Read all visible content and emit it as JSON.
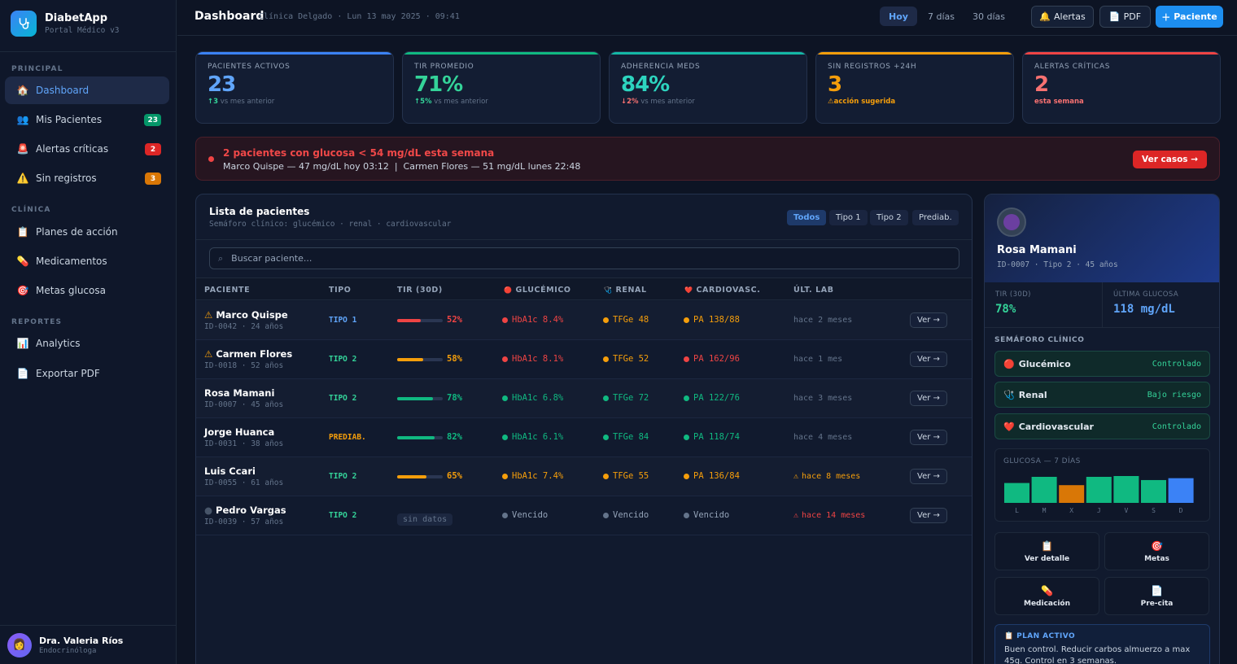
{
  "app": {
    "name": "DiabetApp",
    "subtitle": "Portal Médico v3",
    "logo_icon": "stethoscope-icon"
  },
  "sidebar": {
    "sections": [
      "PRINCIPAL",
      "CLÍNICA",
      "REPORTES"
    ],
    "items": [
      {
        "label": "Dashboard",
        "icon": "🏠",
        "icon_name": "home-icon",
        "active": true
      },
      {
        "label": "Mis Pacientes",
        "icon": "👥",
        "icon_name": "users-icon",
        "badge": "23",
        "badge_color": "#059669"
      },
      {
        "label": "Alertas críticas",
        "icon": "🚨",
        "icon_name": "siren-icon",
        "badge": "2",
        "badge_color": "#dc2626"
      },
      {
        "label": "Sin registros",
        "icon": "⚠️",
        "icon_name": "warning-icon",
        "badge": "3",
        "badge_color": "#d97706"
      },
      {
        "label": "Planes de acción",
        "icon": "📋",
        "icon_name": "clipboard-icon"
      },
      {
        "label": "Medicamentos",
        "icon": "💊",
        "icon_name": "pill-icon"
      },
      {
        "label": "Metas glucosa",
        "icon": "🎯",
        "icon_name": "target-icon"
      },
      {
        "label": "Analytics",
        "icon": "📊",
        "icon_name": "chart-icon"
      },
      {
        "label": "Exportar PDF",
        "icon": "📄",
        "icon_name": "document-icon"
      }
    ],
    "user": {
      "name": "Dra. Valeria Ríos",
      "role": "Endocrinóloga"
    }
  },
  "topbar": {
    "title": "Dashboard",
    "subtitle": "Clínica Delgado · Lun 13 may 2025 · 09:41",
    "ranges": [
      "Hoy",
      "7 días",
      "30 días"
    ],
    "active_range": "Hoy",
    "alerts_label": "Alertas",
    "pdf_label": "PDF",
    "patient_label": "Paciente"
  },
  "kpis": [
    {
      "label": "PACIENTES ACTIVOS",
      "value": "23",
      "delta": "3",
      "delta_suffix": "vs mes anterior",
      "color": "#60a5fa",
      "bar": "#3b82f6",
      "delta_color": "#34d399",
      "arrow": "↑"
    },
    {
      "label": "TIR PROMEDIO",
      "value": "71%",
      "delta": "5%",
      "delta_suffix": "vs mes anterior",
      "color": "#34d399",
      "bar": "#10b981",
      "delta_color": "#34d399",
      "arrow": "↑"
    },
    {
      "label": "ADHERENCIA MEDS",
      "value": "84%",
      "delta": "2%",
      "delta_suffix": "vs mes anterior",
      "color": "#2dd4bf",
      "bar": "#14b8a6",
      "delta_color": "#f87171",
      "arrow": "↓"
    },
    {
      "label": "SIN REGISTROS +24H",
      "value": "3",
      "delta": "acción sugerida",
      "delta_suffix": "",
      "color": "#f59e0b",
      "bar": "#f59e0b",
      "delta_color": "#f59e0b",
      "arrow": "⚠"
    },
    {
      "label": "ALERTAS CRÍTICAS",
      "value": "2",
      "delta": "esta semana",
      "delta_suffix": "",
      "color": "#f87171",
      "bar": "#ef4444",
      "delta_color": "#f87171",
      "arrow": ""
    }
  ],
  "alert": {
    "title": "2 pacientes con glucosa < 54 mg/dL esta semana",
    "detail": "Marco Quispe — 47 mg/dL hoy 03:12  |  Carmen Flores — 51 mg/dL lunes 22:48",
    "button": "Ver casos →"
  },
  "patients_panel": {
    "title": "Lista de pacientes",
    "subtitle": "Semáforo clínico: glucémico · renal · cardiovascular",
    "filters": [
      "Todos",
      "Tipo 1",
      "Tipo 2",
      "Prediab."
    ],
    "active_filter": "Todos",
    "search_placeholder": "Buscar paciente...",
    "columns": [
      "PACIENTE",
      "TIPO",
      "TIR (30D)",
      "GLUCÉMICO",
      "RENAL",
      "CARDIOVASC.",
      "ÚLT. LAB"
    ],
    "column_icons": {
      "glucemico": "🔴",
      "renal": "🩺",
      "cardio": "❤️"
    },
    "view_label": "Ver →",
    "rows": [
      {
        "flag": "⚠",
        "flag_color": "#f59e0b",
        "name": "Marco Quispe",
        "id": "ID-0042 · 24 años",
        "type": "TIPO 1",
        "type_color": "#60a5fa",
        "tir": 52,
        "tir_label": "52%",
        "tir_color": "#ef4444",
        "glu": "HbA1c 8.4%",
        "glu_color": "#ef4444",
        "renal": "TFGe 48",
        "renal_color": "#f59e0b",
        "cardio": "PA 138/88",
        "cardio_color": "#f59e0b",
        "lab": "hace 2 meses",
        "lab_color": "#64748b",
        "lab_warn": false
      },
      {
        "flag": "⚠",
        "flag_color": "#f59e0b",
        "name": "Carmen Flores",
        "id": "ID-0018 · 52 años",
        "type": "TIPO 2",
        "type_color": "#34d399",
        "tir": 58,
        "tir_label": "58%",
        "tir_color": "#f59e0b",
        "glu": "HbA1c 8.1%",
        "glu_color": "#ef4444",
        "renal": "TFGe 52",
        "renal_color": "#f59e0b",
        "cardio": "PA 162/96",
        "cardio_color": "#ef4444",
        "lab": "hace 1 mes",
        "lab_color": "#64748b",
        "lab_warn": false
      },
      {
        "flag": "",
        "flag_color": "",
        "name": "Rosa Mamani",
        "id": "ID-0007 · 45 años",
        "type": "TIPO 2",
        "type_color": "#34d399",
        "tir": 78,
        "tir_label": "78%",
        "tir_color": "#10b981",
        "glu": "HbA1c 6.8%",
        "glu_color": "#10b981",
        "renal": "TFGe 72",
        "renal_color": "#10b981",
        "cardio": "PA 122/76",
        "cardio_color": "#10b981",
        "lab": "hace 3 meses",
        "lab_color": "#64748b",
        "lab_warn": false
      },
      {
        "flag": "",
        "flag_color": "",
        "name": "Jorge Huanca",
        "id": "ID-0031 · 38 años",
        "type": "PREDIAB.",
        "type_color": "#f59e0b",
        "tir": 82,
        "tir_label": "82%",
        "tir_color": "#10b981",
        "glu": "HbA1c 6.1%",
        "glu_color": "#10b981",
        "renal": "TFGe 84",
        "renal_color": "#10b981",
        "cardio": "PA 118/74",
        "cardio_color": "#10b981",
        "lab": "hace 4 meses",
        "lab_color": "#64748b",
        "lab_warn": false
      },
      {
        "flag": "",
        "flag_color": "",
        "name": "Luis Ccari",
        "id": "ID-0055 · 61 años",
        "type": "TIPO 2",
        "type_color": "#34d399",
        "tir": 65,
        "tir_label": "65%",
        "tir_color": "#f59e0b",
        "glu": "HbA1c 7.4%",
        "glu_color": "#f59e0b",
        "renal": "TFGe 55",
        "renal_color": "#f59e0b",
        "cardio": "PA 136/84",
        "cardio_color": "#f59e0b",
        "lab": "hace 8 meses",
        "lab_color": "#f59e0b",
        "lab_warn": true
      },
      {
        "flag": "●",
        "flag_color": "#475569",
        "name": "Pedro Vargas",
        "id": "ID-0039 · 57 años",
        "type": "TIPO 2",
        "type_color": "#34d399",
        "tir": null,
        "tir_label": "sin datos",
        "tir_color": "",
        "glu": "Vencido",
        "glu_color": "#64748b",
        "renal": "Vencido",
        "renal_color": "#64748b",
        "cardio": "Vencido",
        "cardio_color": "#64748b",
        "lab": "hace 14 meses",
        "lab_color": "#ef4444",
        "lab_warn": true
      }
    ]
  },
  "detail": {
    "name": "Rosa Mamani",
    "sub": "ID-0007 · Tipo 2 · 45 años",
    "tir_label": "TIR (30D)",
    "tir_value": "78%",
    "last_label": "ÚLTIMA GLUCOSA",
    "last_value": "118 mg/dL",
    "semaforo_title": "SEMÁFORO CLÍNICO",
    "semaforo": [
      {
        "name": "Glucémico",
        "icon": "🔴",
        "status": "Controlado"
      },
      {
        "name": "Renal",
        "icon": "🩺",
        "status": "Bajo riesgo"
      },
      {
        "name": "Cardiovascular",
        "icon": "❤️",
        "status": "Controlado"
      }
    ],
    "actions": [
      {
        "label": "Ver detalle",
        "icon": "📋"
      },
      {
        "label": "Metas",
        "icon": "🎯"
      },
      {
        "label": "Medicación",
        "icon": "💊"
      },
      {
        "label": "Pre-cita",
        "icon": "📄"
      }
    ],
    "plan_title": "📋 PLAN ACTIVO",
    "plan_text": "Buen control. Reducir carbos almuerzo a max 45g. Control en 3 semanas."
  },
  "chart_data": {
    "type": "bar",
    "title": "GLUCOSA — 7 DÍAS",
    "categories": [
      "L",
      "M",
      "X",
      "J",
      "V",
      "S",
      "D"
    ],
    "values": [
      0.74,
      0.97,
      0.66,
      0.97,
      1.0,
      0.85,
      0.92
    ],
    "colors": [
      "#10b981",
      "#10b981",
      "#d97706",
      "#10b981",
      "#10b981",
      "#10b981",
      "#3b82f6"
    ]
  }
}
